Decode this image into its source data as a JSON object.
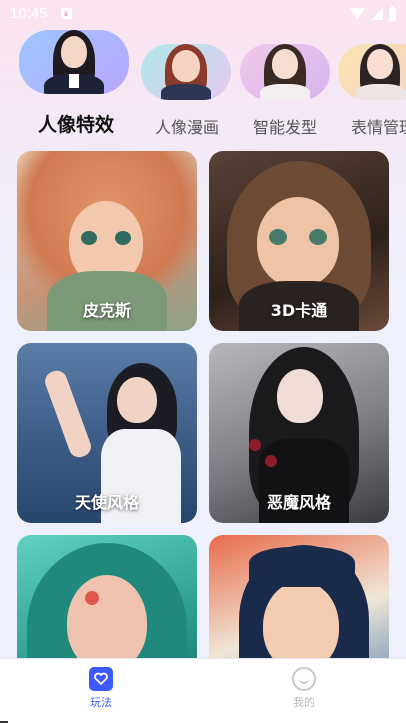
{
  "status_bar": {
    "time": "10:45"
  },
  "tabs": [
    {
      "label": "人像特效",
      "active": true
    },
    {
      "label": "人像漫画",
      "active": false
    },
    {
      "label": "智能发型",
      "active": false
    },
    {
      "label": "表情管理",
      "active": false
    }
  ],
  "cards": [
    {
      "label": "皮克斯"
    },
    {
      "label": "3D卡通"
    },
    {
      "label": "天使风格"
    },
    {
      "label": "恶魔风格"
    },
    {
      "label": ""
    },
    {
      "label": ""
    }
  ],
  "bottom_nav": [
    {
      "label": "玩法",
      "active": true,
      "icon": "heart-chat-icon"
    },
    {
      "label": "我的",
      "active": false,
      "icon": "smile-icon"
    }
  ],
  "colors": {
    "accent": "#3d5afe",
    "inactive": "#b8b8bd"
  }
}
